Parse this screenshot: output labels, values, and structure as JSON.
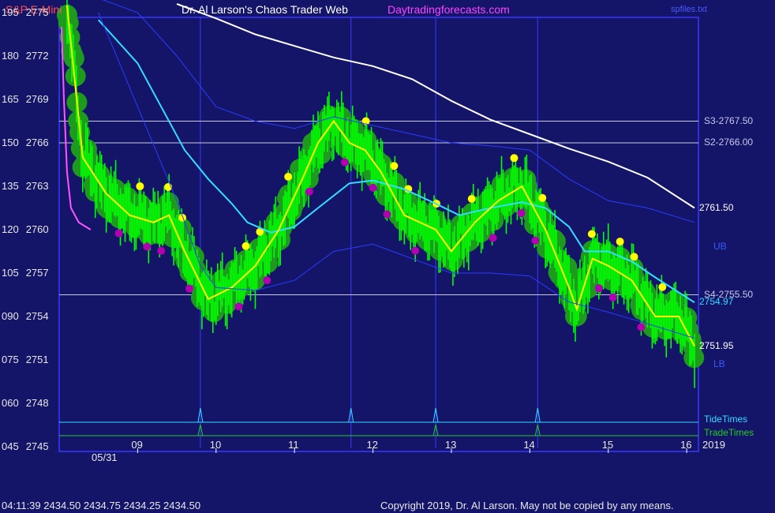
{
  "header": {
    "instrument": "S&P E-Mini",
    "site_title": "Dr. Al Larson's Chaos Trader Web",
    "site_url": "Daytradingforecasts.com",
    "chart_file": "spfiles.txt"
  },
  "footer": {
    "quote": "04:11:39  2434.50  2434.75  2434.25  2434.50",
    "copyright": "Copyright 2019, Dr. Al Larson. May not be copied by any means."
  },
  "colors": {
    "background": "#141469",
    "frame": "#3a3aff",
    "price_bars": "#00ff00",
    "green_dots": "#1e9a1e",
    "yellow_dots": "#ffff00",
    "magenta_dots": "#b000b0",
    "yellow_line": "#ffff00",
    "magenta_line": "#ff55ff",
    "cyan_line": "#33ddff",
    "white_line": "#ffffff",
    "blue_lines": "#2a3cff",
    "tide_times": "#33ddff",
    "trade_times": "#22cc22"
  },
  "chart_data": {
    "type": "line",
    "title": "S&P E-Mini",
    "ylim": [
      2745,
      2775
    ],
    "y_ticks": [
      {
        "left": "195",
        "price": "2775",
        "v": 2775
      },
      {
        "left": "180",
        "price": "2772",
        "v": 2772
      },
      {
        "left": "165",
        "price": "2769",
        "v": 2769
      },
      {
        "left": "150",
        "price": "2766",
        "v": 2766
      },
      {
        "left": "135",
        "price": "2763",
        "v": 2763
      },
      {
        "left": "120",
        "price": "2760",
        "v": 2760
      },
      {
        "left": "105",
        "price": "2757",
        "v": 2757
      },
      {
        "left": "090",
        "price": "2754",
        "v": 2754
      },
      {
        "left": "075",
        "price": "2751",
        "v": 2751
      },
      {
        "left": "060",
        "price": "2748",
        "v": 2748
      },
      {
        "left": "045",
        "price": "2745",
        "v": 2745
      }
    ],
    "xlim": [
      8.0,
      16.15
    ],
    "x_ticks": [
      {
        "label": "09",
        "x": 9
      },
      {
        "label": "10",
        "x": 10
      },
      {
        "label": "11",
        "x": 11
      },
      {
        "label": "12",
        "x": 12
      },
      {
        "label": "13",
        "x": 13
      },
      {
        "label": "14",
        "x": 14
      },
      {
        "label": "15",
        "x": 15
      },
      {
        "label": "16",
        "x": 16
      }
    ],
    "date_label": "05/31",
    "year_label": "2019",
    "levels": [
      {
        "label": "S3-2767.50",
        "value": 2767.5
      },
      {
        "label": "S2-2766.00",
        "value": 2766.0
      },
      {
        "label": "S4-2755.50",
        "value": 2755.5
      }
    ],
    "end_labels": [
      {
        "label": "2761.50",
        "value": 2761.5,
        "color": "#ffffff"
      },
      {
        "label": "UB",
        "value": 2758.8,
        "color": "#3a5aff"
      },
      {
        "label": "2754.97",
        "value": 2754.97,
        "color": "#33ddff"
      },
      {
        "label": "2751.95",
        "value": 2751.95,
        "color": "#ffffff"
      },
      {
        "label": "LB",
        "value": 2750.7,
        "color": "#3a5aff"
      }
    ],
    "tide_times": [
      9.8,
      11.72,
      12.8,
      14.1
    ],
    "trade_times": [
      9.8,
      12.8,
      14.1
    ],
    "tide_label": "TideTimes",
    "trade_label": "TradeTimes",
    "series": [
      {
        "name": "",
        "color": "#ffffff",
        "x": [
          9.5,
          10.0,
          10.5,
          11.0,
          11.5,
          12.0,
          12.5,
          13.0,
          13.5,
          14.0,
          14.5,
          15.0,
          15.5,
          16.1
        ],
        "values": [
          2775.6,
          2774.6,
          2773.5,
          2772.7,
          2771.9,
          2771.3,
          2770.4,
          2768.9,
          2767.6,
          2766.6,
          2765.6,
          2764.7,
          2763.6,
          2761.5
        ]
      },
      {
        "name": "",
        "color": "#33ddff",
        "x": [
          8.5,
          9.0,
          9.3,
          9.6,
          9.9,
          10.2,
          10.4,
          10.7,
          11.0,
          11.3,
          11.7,
          12.0,
          12.4,
          12.8,
          13.1,
          13.5,
          13.9,
          14.2,
          14.5,
          14.7,
          15.0,
          15.3,
          15.6,
          16.1
        ],
        "values": [
          2774.5,
          2771.5,
          2768.5,
          2765.5,
          2763.5,
          2761.8,
          2760.5,
          2759.8,
          2760.2,
          2761.5,
          2763.2,
          2763.4,
          2762.8,
          2761.8,
          2761.0,
          2761.5,
          2761.9,
          2761.5,
          2760.2,
          2758.5,
          2758.5,
          2757.8,
          2756.7,
          2754.97
        ]
      },
      {
        "name": "",
        "color": "#ffff00",
        "x": [
          8.1,
          8.3,
          8.6,
          8.9,
          9.2,
          9.4,
          9.6,
          9.9,
          10.2,
          10.5,
          10.8,
          11.1,
          11.3,
          11.5,
          11.7,
          11.9,
          12.1,
          12.4,
          12.8,
          13.0,
          13.3,
          13.6,
          13.9,
          14.2,
          14.5,
          14.6,
          14.8,
          15.0,
          15.3,
          15.6,
          15.9,
          16.1
        ],
        "values": [
          2775.5,
          2765.0,
          2762.5,
          2761.0,
          2760.5,
          2761.0,
          2758.5,
          2755.2,
          2756.0,
          2757.5,
          2760.0,
          2763.5,
          2766.0,
          2767.5,
          2766.0,
          2765.5,
          2764.0,
          2761.0,
          2760.0,
          2758.5,
          2760.5,
          2762.0,
          2763.0,
          2760.0,
          2756.0,
          2754.5,
          2758.0,
          2757.5,
          2756.5,
          2754.0,
          2754.0,
          2751.95
        ]
      },
      {
        "name": "",
        "color": "#ff55ff",
        "x": [
          8.03,
          8.06,
          8.1,
          8.15,
          8.25,
          8.4
        ],
        "values": [
          2774.0,
          2769.0,
          2764.0,
          2761.5,
          2760.5,
          2760.0
        ]
      },
      {
        "name": "",
        "color": "#2a3cff",
        "x": [
          8.5,
          9.0,
          9.5,
          10.0,
          10.5,
          11.0,
          11.5,
          12.0,
          12.5,
          13.0,
          13.5,
          14.0,
          14.5,
          15.0,
          15.5,
          16.1
        ],
        "values": [
          2776.0,
          2775.0,
          2772.0,
          2768.5,
          2767.5,
          2767.0,
          2767.8,
          2767.2,
          2766.6,
          2766.0,
          2765.8,
          2765.5,
          2763.5,
          2762.0,
          2761.5,
          2760.5
        ]
      },
      {
        "name": "",
        "color": "#2a3cff",
        "x": [
          8.5,
          9.0,
          9.5,
          9.8,
          10.0,
          10.5,
          11.0,
          11.5,
          12.0,
          12.5,
          13.0,
          13.5,
          14.0,
          14.5,
          15.0,
          15.5,
          16.1
        ],
        "values": [
          2775.0,
          2768.5,
          2762.0,
          2757.5,
          2756.0,
          2755.8,
          2756.5,
          2758.5,
          2759.0,
          2758.0,
          2757.0,
          2757.0,
          2756.8,
          2755.0,
          2754.3,
          2753.5,
          2752.5
        ]
      }
    ]
  }
}
